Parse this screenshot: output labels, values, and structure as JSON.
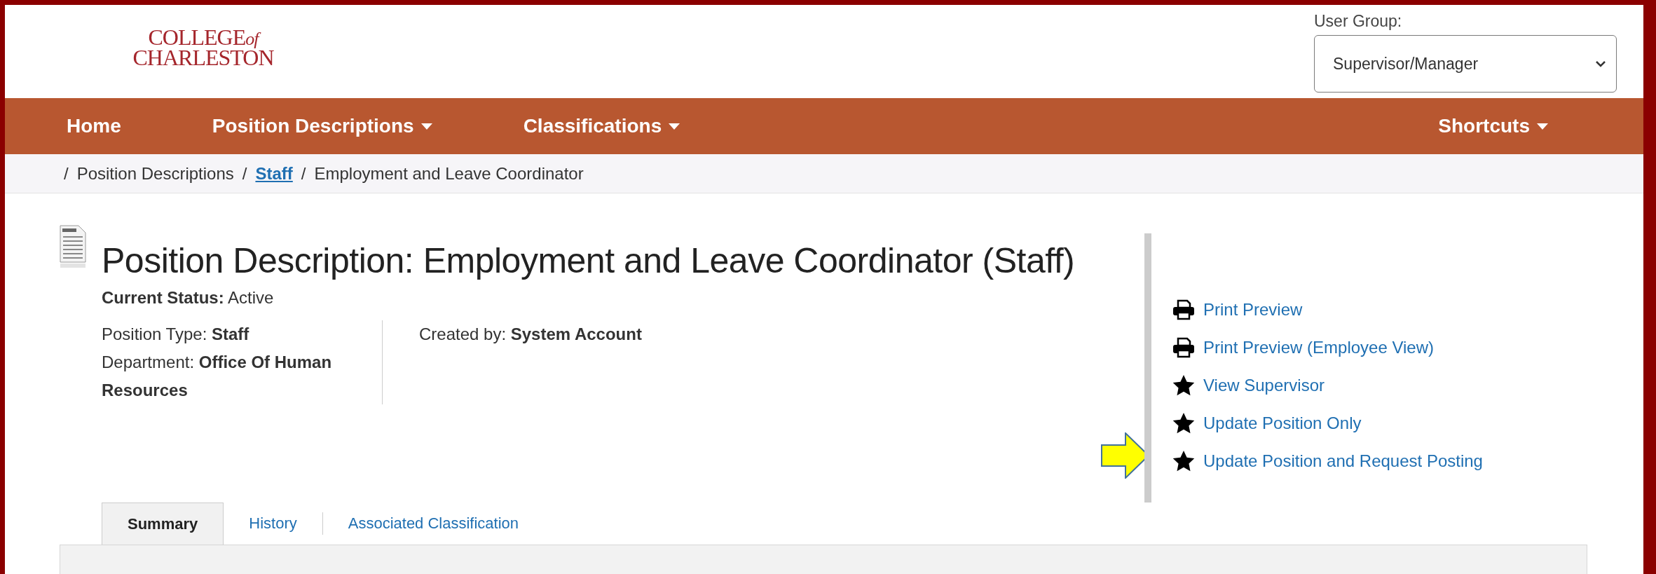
{
  "logo": {
    "line1": "COLLEGE",
    "small": "of",
    "line2": "CHARLESTON"
  },
  "user_group": {
    "label": "User Group:",
    "value": "Supervisor/Manager"
  },
  "nav": [
    {
      "label": "Home",
      "dropdown": false
    },
    {
      "label": "Position Descriptions",
      "dropdown": true
    },
    {
      "label": "Classifications",
      "dropdown": true
    }
  ],
  "nav_right": {
    "label": "Shortcuts",
    "dropdown": true
  },
  "breadcrumb": [
    {
      "separator": "/",
      "label": "Position Descriptions",
      "link": false
    },
    {
      "separator": "/",
      "label": "Staff",
      "link": true
    },
    {
      "separator": "/",
      "label": "Employment and Leave Coordinator",
      "link": false
    }
  ],
  "title": "Position Description: Employment and Leave Coordinator (Staff)",
  "status": {
    "label": "Current Status:",
    "value": "Active"
  },
  "details_left": [
    "Position Type: **Staff**",
    "Department: **Office Of Human Resources**"
  ],
  "details_right": [
    "Created by: **System Account**"
  ],
  "actions": [
    {
      "label": "Print Preview",
      "kind": "print"
    },
    {
      "label": "Print Preview (Employee View)",
      "kind": "print"
    },
    {
      "label": "View Supervisor",
      "kind": "star"
    },
    {
      "label": "Update Position Only",
      "kind": "star"
    },
    {
      "label": "Update Position and Request Posting",
      "kind": "star"
    }
  ],
  "tabs": [
    {
      "label": "Summary",
      "selected": true
    },
    {
      "label": "History",
      "selected": false
    },
    {
      "label": "Associated Classification",
      "selected": false
    }
  ]
}
